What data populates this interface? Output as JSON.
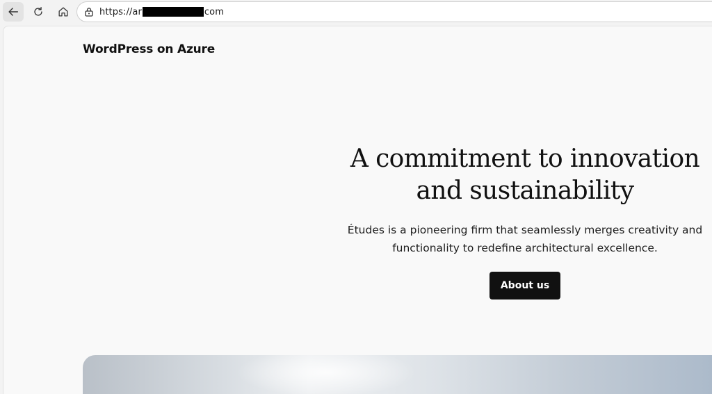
{
  "browser": {
    "url_prefix": "https://ar",
    "url_suffix": "com"
  },
  "site": {
    "title": "WordPress on Azure"
  },
  "hero": {
    "heading_line1": "A commitment to innovation",
    "heading_line2": "and sustainability",
    "text_line1": "Études is a pioneering firm that seamlessly merges creativity and",
    "text_line2": "functionality to redefine architectural excellence.",
    "button_label": "About us"
  },
  "icons": {
    "back": "arrow-left-icon",
    "reload": "reload-icon",
    "home": "home-icon",
    "site_info": "lock-icon"
  }
}
